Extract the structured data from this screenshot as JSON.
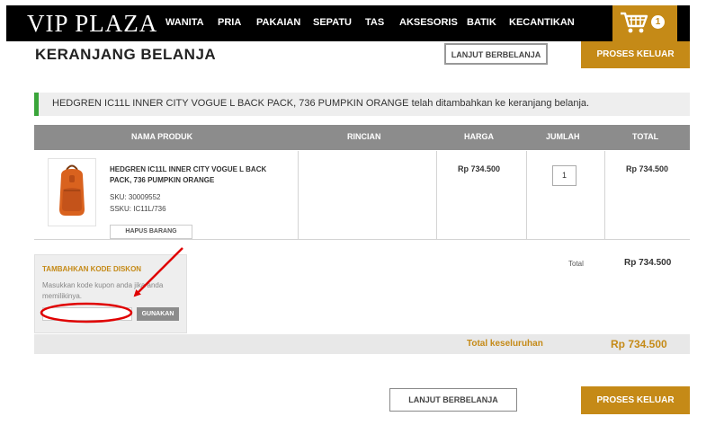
{
  "header": {
    "logo": "VIP PLAZA",
    "nav": [
      "WANITA",
      "PRIA",
      "PAKAIAN",
      "SEPATU",
      "TAS",
      "AKSESORIS",
      "BATIK",
      "KECANTIKAN"
    ],
    "cart_count": "1"
  },
  "page": {
    "title": "KERANJANG BELANJA",
    "continue_label": "LANJUT BERBELANJA",
    "checkout_label": "PROSES KELUAR"
  },
  "notice": {
    "text": "HEDGREN IC11L INNER CITY VOGUE L BACK PACK, 736 PUMPKIN ORANGE telah ditambahkan ke keranjang belanja."
  },
  "table": {
    "headers": {
      "product": "NAMA PRODUK",
      "details": "RINCIAN",
      "price": "HARGA",
      "quantity": "JUMLAH",
      "total": "TOTAL"
    },
    "item": {
      "name": "HEDGREN IC11L INNER CITY VOGUE L BACK PACK, 736 PUMPKIN ORANGE",
      "sku": "SKU: 30009552",
      "ssku": "SSKU: IC11L/736",
      "remove_label": "HAPUS BARANG",
      "price": "Rp 734.500",
      "quantity": "1",
      "total": "Rp 734.500"
    }
  },
  "discount": {
    "title": "TAMBAHKAN KODE DISKON",
    "help": "Masukkan kode kupon anda jika anda memilikinya.",
    "input_value": "",
    "apply_label": "GUNAKAN"
  },
  "summary": {
    "subtotal_label": "Total",
    "subtotal_value": "Rp 734.500",
    "grand_label": "Total keseluruhan",
    "grand_value": "Rp 734.500"
  },
  "colors": {
    "accent": "#c58a17",
    "header_bg": "#000000",
    "table_header": "#8c8c8c",
    "notice_bar": "#3aa53a",
    "annotation": "#e00000"
  },
  "icons": {
    "cart": "shopping-cart-icon"
  }
}
